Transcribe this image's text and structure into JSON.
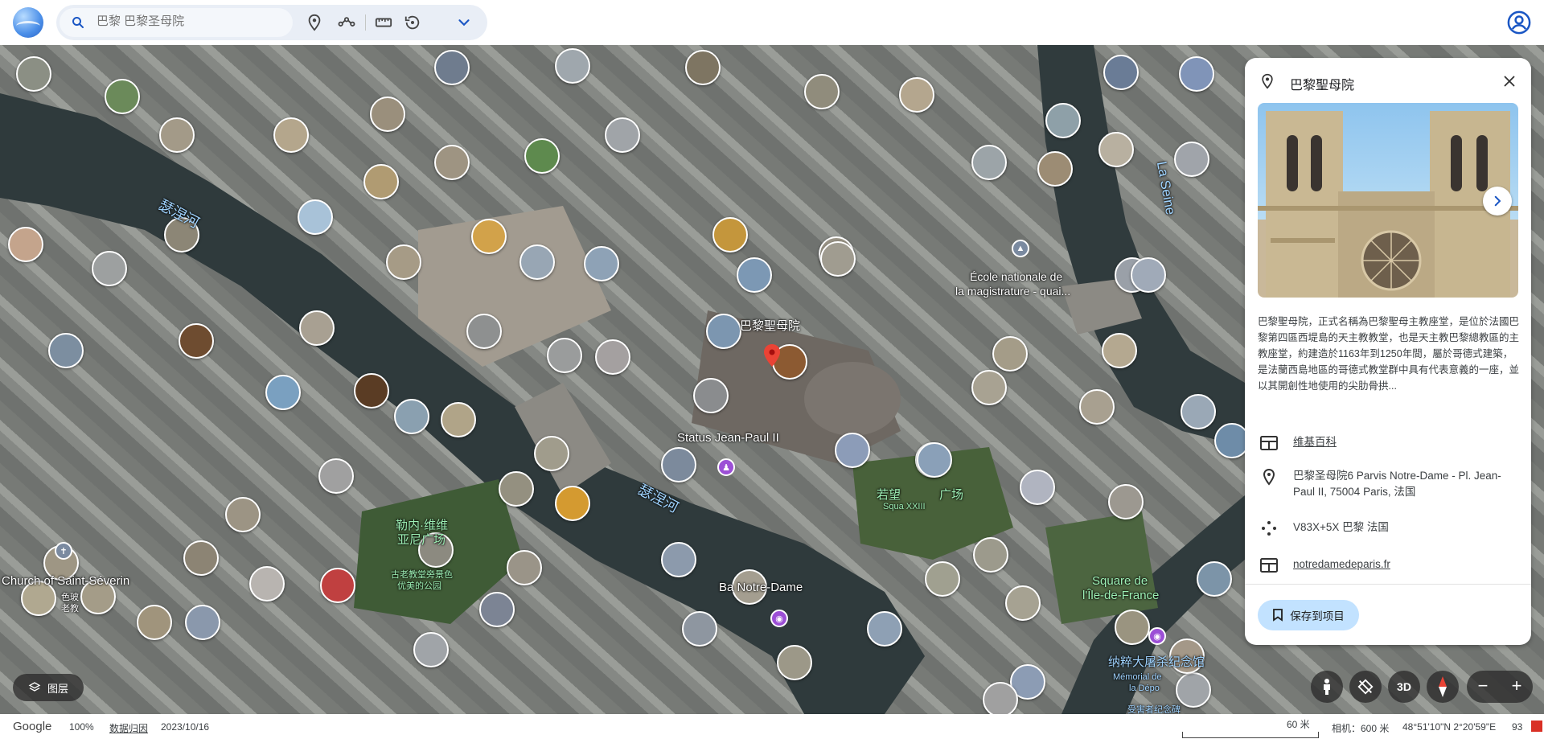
{
  "search": {
    "placeholder": "巴黎 巴黎圣母院"
  },
  "toolbar": {
    "icons": [
      "place-pin-icon",
      "route-icon",
      "ruler-icon",
      "history-icon",
      "chevron-down-icon"
    ]
  },
  "map": {
    "labels": {
      "notre_dame": "巴黎聖母院",
      "statue": "Status Jean-Paul II",
      "seine_1": "瑟涅河",
      "seine_2": "瑟涅河",
      "la_seine": "La Seine",
      "ecole": "École nationale de",
      "ecole_2": "la magistrature - quai...",
      "square_jp": "若望",
      "square_jp_2": "广场",
      "square_jp_sub": "Squa XXIII",
      "viviani": "勒内·维维",
      "viviani_2": "亚尼广场",
      "viviani_3": "古老教堂旁景色",
      "viviani_4": "优美的公园",
      "saint_severin": "Church of Saint-Séverin",
      "severin_sub_1": "色玻",
      "severin_sub_2": "老教",
      "bateaux": "Ba Notre-Dame",
      "square_ile": "Square de",
      "square_ile_2": "l'Île-de-France",
      "memorial": "纳粹大屠杀纪念馆",
      "memorial_sub": "Mémorial de",
      "memorial_sub_2": "la Dépo",
      "memorial_sub_3": "受害者纪念碑"
    }
  },
  "panel": {
    "title": "巴黎聖母院",
    "description": "巴黎聖母院，正式名稱為巴黎聖母主教座堂，是位於法國巴黎第四區西堤島的天主教教堂，也是天主教巴黎總教區的主教座堂，約建造於1163年到1250年間，屬於哥德式建築，是法蘭西島地區的哥德式教堂群中具有代表意義的一座，並以其開創性地使用的尖肋骨拱...",
    "wiki_link": "维基百科",
    "address": "巴黎圣母院6 Parvis Notre-Dame - Pl. Jean-Paul II, 75004 Paris, 法国",
    "plus_code": "V83X+5X 巴黎 法国",
    "website": "notredamedeparis.fr",
    "save_button": "保存到项目"
  },
  "controls": {
    "layers": "图层",
    "three_d": "3D",
    "zoom_out": "−",
    "zoom_in": "+"
  },
  "status": {
    "brand": "Google",
    "zoom": "100%",
    "data_attribution": "数据归因",
    "date": "2023/10/16",
    "scale": "60 米",
    "camera": "相机：600 米",
    "coords": "48°51'10\"N 2°20'59\"E",
    "extra": "93"
  }
}
